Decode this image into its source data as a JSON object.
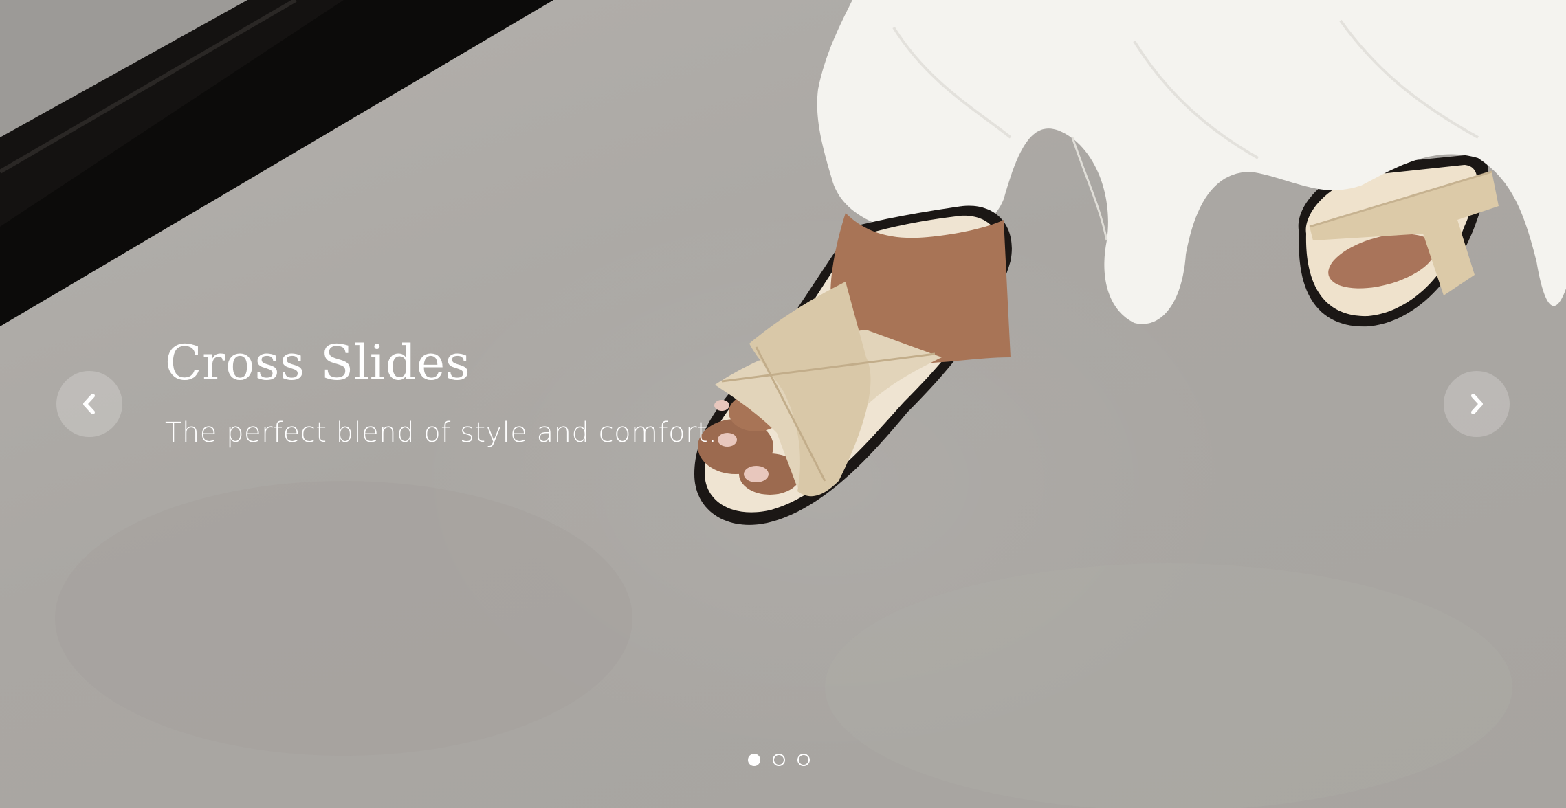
{
  "slide": {
    "title": "Cross Slides",
    "subtitle": "The perfect blend of style and comfort."
  },
  "controls": {
    "prev_icon": "chevron-left-icon",
    "next_icon": "chevron-right-icon"
  },
  "pagination": {
    "count": 3,
    "active_index": 0
  },
  "colors": {
    "text": "#ffffff",
    "floor": "#aaa7a3",
    "dress": "#f4f3ef",
    "sandal_strap": "#e2d4ba",
    "sole": "#1b1715"
  }
}
